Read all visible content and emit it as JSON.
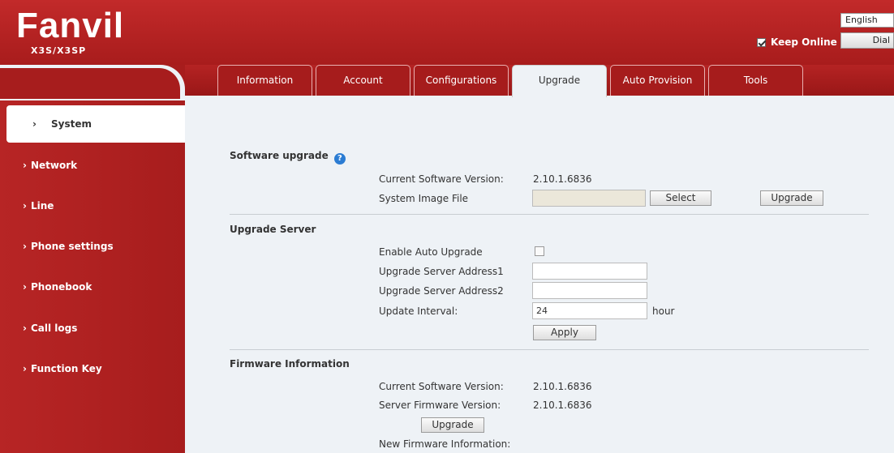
{
  "header": {
    "brand": "Fanvil",
    "model": "X3S/X3SP",
    "language": "English",
    "keep_online": "Keep Online",
    "dial": "Dial"
  },
  "tabs": [
    {
      "label": "Information"
    },
    {
      "label": "Account"
    },
    {
      "label": "Configurations"
    },
    {
      "label": "Upgrade"
    },
    {
      "label": "Auto Provision"
    },
    {
      "label": "Tools"
    }
  ],
  "sidebar": {
    "items": [
      {
        "label": "System"
      },
      {
        "label": "Network"
      },
      {
        "label": "Line"
      },
      {
        "label": "Phone settings"
      },
      {
        "label": "Phonebook"
      },
      {
        "label": "Call logs"
      },
      {
        "label": "Function Key"
      }
    ]
  },
  "software_upgrade": {
    "title": "Software upgrade",
    "help": "?",
    "current_version_label": "Current Software Version:",
    "current_version": "2.10.1.6836",
    "image_file_label": "System Image File",
    "image_file_value": "",
    "select_label": "Select",
    "upgrade_label": "Upgrade"
  },
  "upgrade_server": {
    "title": "Upgrade Server",
    "enable_auto_label": "Enable Auto Upgrade",
    "server1_label": "Upgrade Server Address1",
    "server1_value": "",
    "server2_label": "Upgrade Server Address2",
    "server2_value": "",
    "interval_label": "Update Interval:",
    "interval_value": "24",
    "interval_unit": "hour",
    "apply_label": "Apply"
  },
  "firmware_info": {
    "title": "Firmware Information",
    "current_version_label": "Current Software Version:",
    "current_version": "2.10.1.6836",
    "server_version_label": "Server Firmware Version:",
    "server_version": "2.10.1.6836",
    "upgrade_label": "Upgrade",
    "new_info_label": "New Firmware Information:"
  }
}
